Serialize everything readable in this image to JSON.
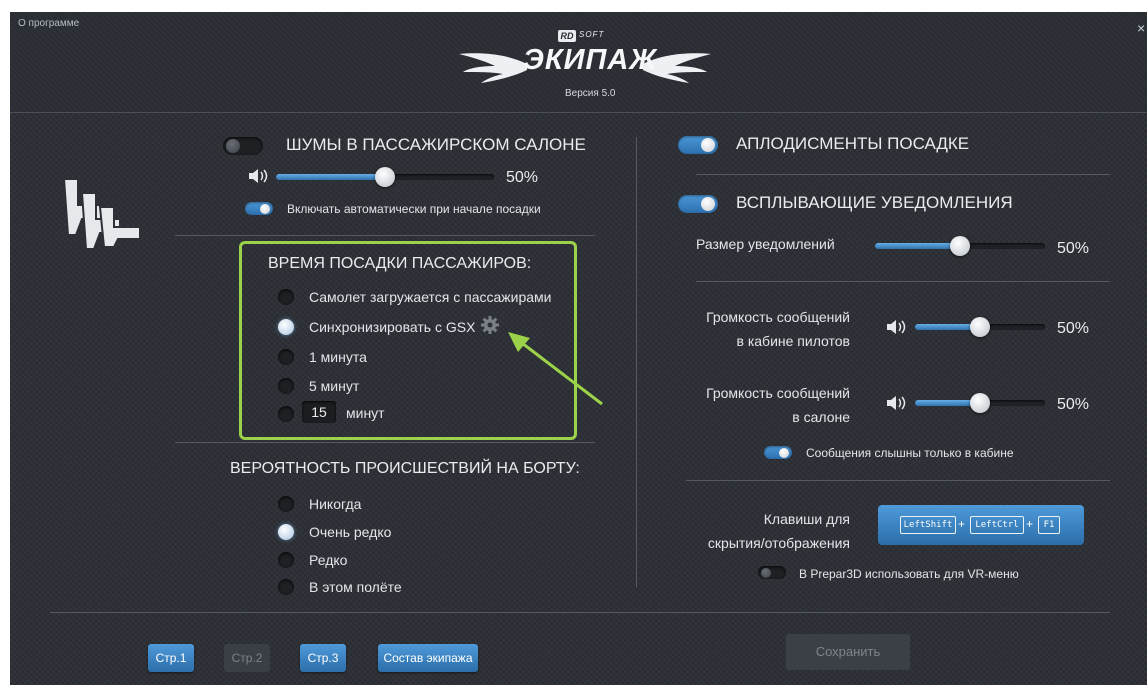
{
  "header": {
    "about_link": "О программе",
    "close": "×",
    "logo": {
      "rd": "RD",
      "soft": "SOFT",
      "title": "ЭКИПАЖ",
      "version": "Версия 5.0"
    }
  },
  "left": {
    "cabin_noise": {
      "label": "ШУМЫ В ПАССАЖИРСКОМ САЛОНЕ",
      "enabled": false,
      "volume_pct": 50,
      "volume_label": "50%"
    },
    "auto_on_boarding": {
      "label": "Включать автоматически при начале посадки",
      "enabled": true
    },
    "boarding_time": {
      "title": "ВРЕМЯ ПОСАДКИ ПАССАЖИРОВ:",
      "options": [
        {
          "label": "Самолет загружается с пассажирами",
          "selected": false
        },
        {
          "label": "Синхронизировать с GSX",
          "selected": true
        },
        {
          "label": "1 минута",
          "selected": false
        },
        {
          "label": "5 минут",
          "selected": false
        },
        {
          "label": "минут",
          "value": "15",
          "selected": false
        }
      ]
    },
    "incidents": {
      "title": "ВЕРОЯТНОСТЬ ПРОИСШЕСТВИЙ НА БОРТУ:",
      "options": [
        {
          "label": "Никогда",
          "selected": false
        },
        {
          "label": "Очень редко",
          "selected": true
        },
        {
          "label": "Редко",
          "selected": false
        },
        {
          "label": "В этом полёте",
          "selected": false
        }
      ]
    }
  },
  "right": {
    "applause": {
      "label": "АПЛОДИСМЕНТЫ ПОСАДКЕ",
      "enabled": true
    },
    "popups": {
      "label": "ВСПЛЫВАЮЩИЕ УВЕДОМЛЕНИЯ",
      "enabled": true
    },
    "notif_size": {
      "label": "Размер уведомлений",
      "value_pct": 50,
      "value_label": "50%"
    },
    "cockpit_volume": {
      "label_line1": "Громкость сообщений",
      "label_line2": "в кабине пилотов",
      "value_pct": 50,
      "value_label": "50%"
    },
    "cabin_volume": {
      "label_line1": "Громкость сообщений",
      "label_line2": "в салоне",
      "value_pct": 50,
      "value_label": "50%"
    },
    "cockpit_only": {
      "label": "Сообщения слышны только в кабине",
      "enabled": true
    },
    "hotkeys": {
      "label_line1": "Клавиши для",
      "label_line2": "скрытия/отображения",
      "keys": [
        "LeftShift",
        "LeftCtrl",
        "F1"
      ],
      "plus": "+"
    },
    "vr_menu": {
      "label": "В Prepar3D использовать для VR-меню",
      "enabled": false
    }
  },
  "footer": {
    "page1": "Стр.1",
    "page2": "Стр.2",
    "page3": "Стр.3",
    "crew": "Состав экипажа",
    "save": "Сохранить"
  },
  "colors": {
    "accent": "#3b82c4",
    "highlight": "#9bd24a",
    "background": "#2d3036"
  }
}
